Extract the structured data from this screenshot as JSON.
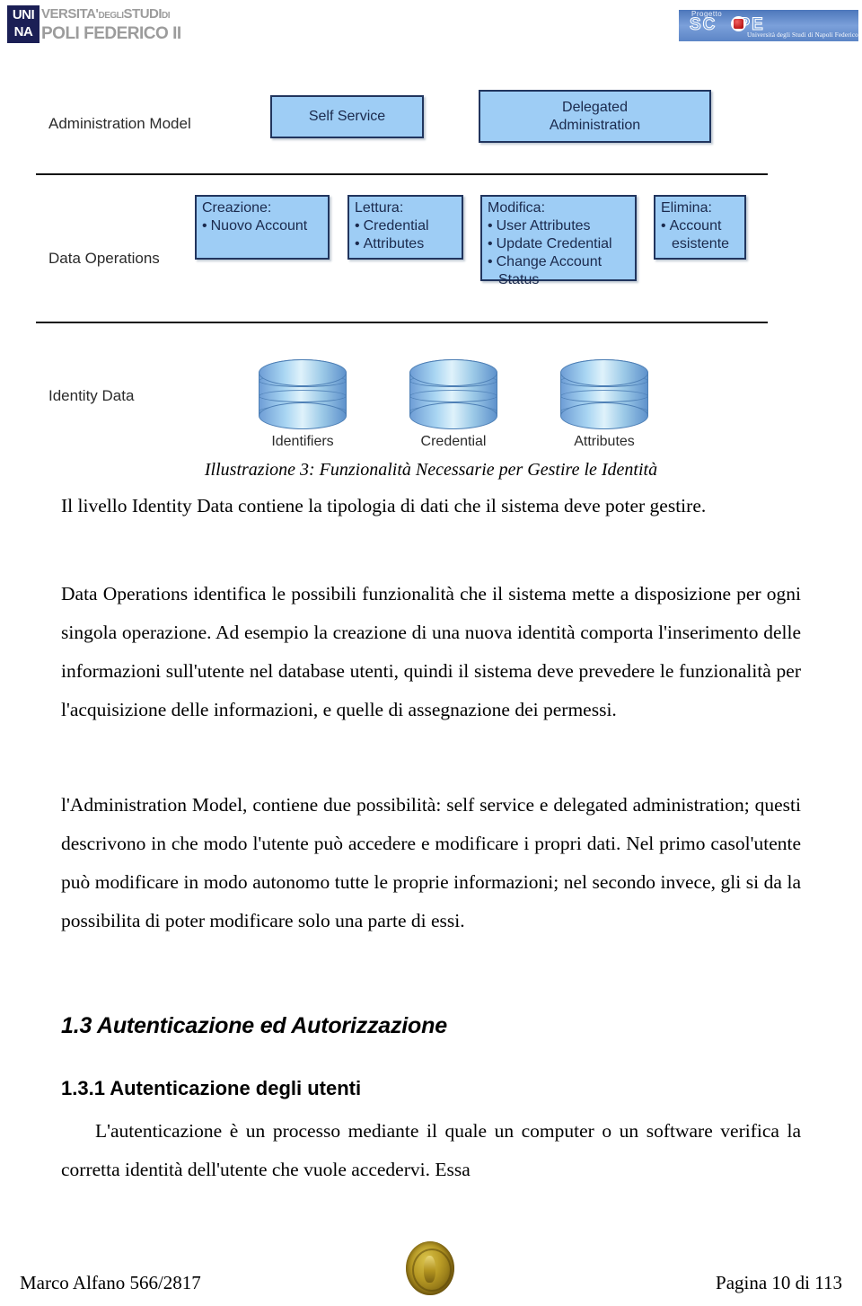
{
  "header": {
    "unina_logo": {
      "mark_line1": "UNI",
      "mark_line2": "NA",
      "line1_a": "VERSITA'",
      "line1_b": "DEGLI",
      "line1_c": "STUDI",
      "line1_d": "DI",
      "line2": "POLI FEDERICO II"
    },
    "scope_logo": {
      "progetto": "Progetto",
      "word_left": "SC",
      "word_right": "PE",
      "subtitle": "Università degli Studi di Napoli Federico II"
    }
  },
  "figure": {
    "rows": {
      "administration_model": "Administration Model",
      "data_operations": "Data Operations",
      "identity_data": "Identity Data"
    },
    "admin_boxes": [
      {
        "title": "Self Service"
      },
      {
        "title_line1": "Delegated",
        "title_line2": "Administration"
      }
    ],
    "operation_boxes": [
      {
        "title": "Creazione:",
        "items": [
          "Nuovo Account"
        ]
      },
      {
        "title": "Lettura:",
        "items": [
          "Credential",
          "Attributes"
        ]
      },
      {
        "title": "Modifica:",
        "items": [
          "User Attributes",
          "Update Credential",
          "Change Account"
        ],
        "continuation": "Status"
      },
      {
        "title": "Elimina:",
        "items": [
          "Account"
        ],
        "continuation": "esistente"
      }
    ],
    "stores": [
      {
        "label": "Identifiers"
      },
      {
        "label": "Credential"
      },
      {
        "label": "Attributes"
      }
    ],
    "colors": {
      "box_fill": "#9ecdf5",
      "box_border": "#21355e",
      "cylinder_fill": "#a8d5f2",
      "divider": "#111111"
    }
  },
  "content": {
    "caption": "Illustrazione 3: Funzionalità Necessarie per Gestire le Identità",
    "paragraph_1": "Il livello Identity Data contiene la tipologia di dati che il sistema deve poter gestire.",
    "paragraph_2": "Data Operations identifica le possibili funzionalità che il sistema mette a disposizione per ogni singola operazione. Ad esempio la creazione di una nuova identità comporta l'inserimento delle informazioni sull'utente nel database utenti, quindi il sistema deve prevedere le funzionalità per l'acquisizione delle informazioni, e quelle di assegnazione dei permessi.",
    "paragraph_3": "l'Administration Model, contiene due possibilità: self service e delegated administration; questi descrivono in che modo l'utente può accedere e modificare i propri dati. Nel primo casol'utente può modificare in modo autonomo tutte le proprie informazioni; nel secondo invece, gli si da la possibilita di poter modificare solo una parte di essi.",
    "heading_section": "1.3 Autenticazione ed Autorizzazione",
    "heading_subsection": "1.3.1 Autenticazione degli utenti",
    "paragraph_4": "L'autenticazione è un processo mediante il quale un computer o un software verifica la corretta identità dell'utente che vuole accedervi. Essa"
  },
  "footer": {
    "author": "Marco Alfano 566/2817",
    "page": "Pagina 10 di 113"
  }
}
